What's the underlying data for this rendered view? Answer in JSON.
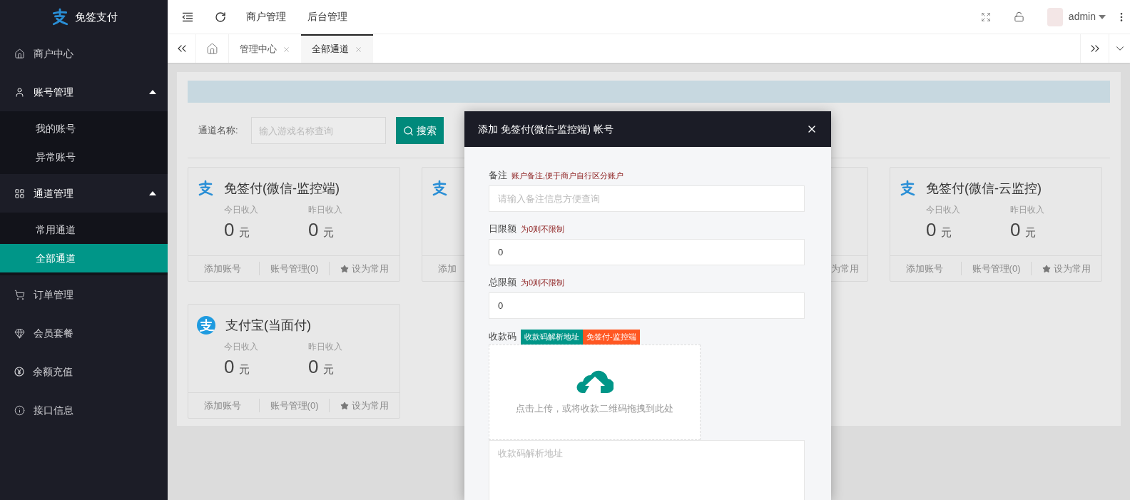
{
  "sidebar": {
    "logo": "免签支付",
    "items": [
      {
        "label": "商户中心",
        "kind": "link",
        "selected": false
      },
      {
        "label": "账号管理",
        "kind": "group",
        "selected": false,
        "expanded": true,
        "children": [
          {
            "label": "我的账号",
            "selected": false
          },
          {
            "label": "异常账号",
            "selected": false
          }
        ]
      },
      {
        "label": "通道管理",
        "kind": "group",
        "selected": false,
        "expanded": true,
        "children": [
          {
            "label": "常用通道",
            "selected": false
          },
          {
            "label": "全部通道",
            "selected": true
          }
        ]
      },
      {
        "label": "订单管理",
        "kind": "link",
        "selected": false
      },
      {
        "label": "会员套餐",
        "kind": "link",
        "selected": false
      },
      {
        "label": "余额充值",
        "kind": "link",
        "selected": false
      },
      {
        "label": "接口信息",
        "kind": "link",
        "selected": false
      }
    ]
  },
  "topbar": {
    "nav": [
      "商户管理",
      "后台管理"
    ],
    "user": "admin"
  },
  "tabs": [
    {
      "label": "管理中心",
      "selected": false
    },
    {
      "label": "全部通道",
      "selected": true
    }
  ],
  "search": {
    "label": "通道名称:",
    "placeholder": "输入游戏名称查询",
    "button": "搜索"
  },
  "cards": [
    {
      "kind": "wechat",
      "title": "免签付(微信-监控端)",
      "today_label": "今日收入",
      "today_value": "0",
      "today_unit": "元",
      "yesterday_label": "昨日收入",
      "yesterday_value": "0",
      "yesterday_unit": "元",
      "add": "添加账号",
      "manage": "账号管理(0)",
      "favorite": "设为常用"
    },
    {
      "kind": "wechat",
      "add": "添加"
    },
    {
      "kind": "none",
      "favorite": "为常用"
    },
    {
      "kind": "wechat",
      "title": "免签付(微信-云监控)",
      "today_label": "今日收入",
      "today_value": "0",
      "today_unit": "元",
      "yesterday_label": "昨日收入",
      "yesterday_value": "0",
      "yesterday_unit": "元",
      "add": "添加账号",
      "manage": "账号管理(0)",
      "favorite": "设为常用"
    },
    {
      "kind": "alipay",
      "title": "支付宝(当面付)",
      "today_label": "今日收入",
      "today_value": "0",
      "today_unit": "元",
      "yesterday_label": "昨日收入",
      "yesterday_value": "0",
      "yesterday_unit": "元",
      "add": "添加账号",
      "manage": "账号管理(0)",
      "favorite": "设为常用"
    }
  ],
  "modal": {
    "title": "添加 免签付(微信-监控端) 帐号",
    "fields": [
      {
        "label": "备注",
        "hint": "账户备注,便于商户自行区分账户",
        "placeholder": "请输入备注信息方便查询"
      },
      {
        "label": "日限额",
        "hint": "为0则不限制",
        "value": "0"
      },
      {
        "label": "总限额",
        "hint": "为0则不限制",
        "value": "0"
      }
    ],
    "qr": {
      "label": "收款码",
      "tags": [
        {
          "text": "收款码解析地址",
          "color": "#009688"
        },
        {
          "text": "免签付-监控端",
          "color": "#ff5722"
        }
      ],
      "upload_text": "点击上传，或将收款二维码拖拽到此处",
      "textarea_placeholder": "收款码解析地址"
    }
  }
}
